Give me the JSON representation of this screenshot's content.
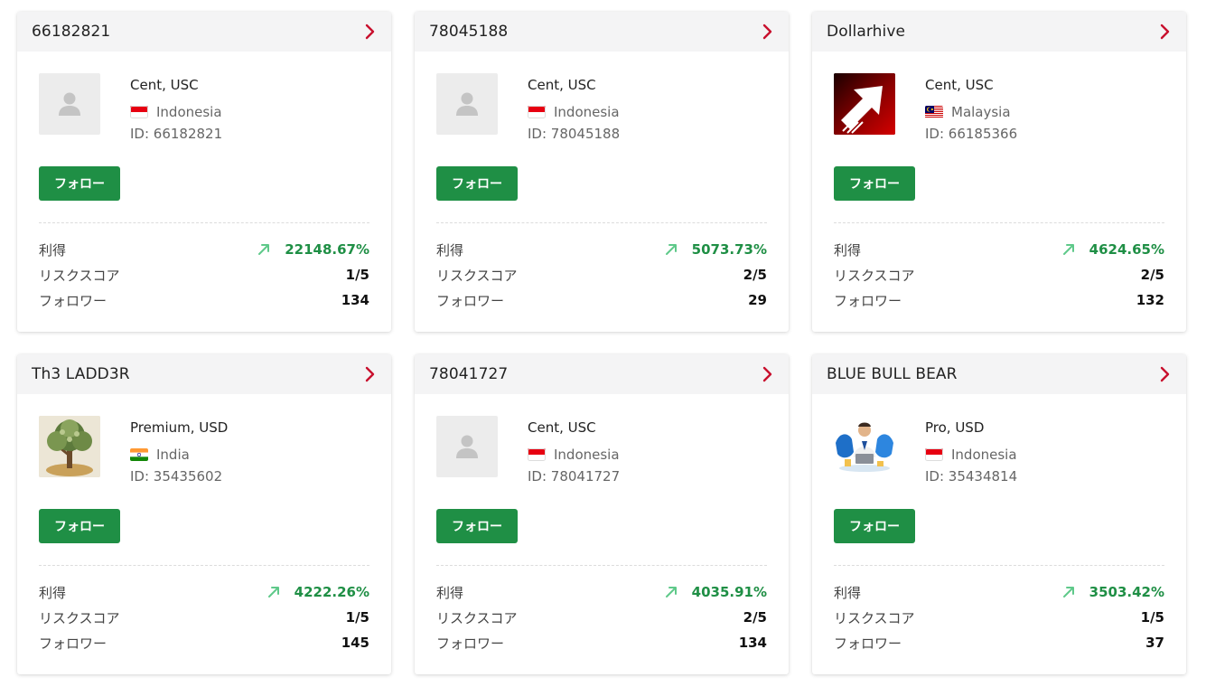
{
  "labels": {
    "follow": "フォロー",
    "profit": "利得",
    "risk": "リスクスコア",
    "followers": "フォロワー"
  },
  "colors": {
    "accent_green": "#1f8f45",
    "chevron_red": "#c8102e",
    "header_bg": "#f4f4f5"
  },
  "cards": [
    {
      "title": "66182821",
      "account": "Cent, USC",
      "country": "Indonesia",
      "flag": "indonesia-flag-icon",
      "id": "ID: 66182821",
      "avatar": "default-user-icon",
      "profit": "22148.67%",
      "risk": "1/5",
      "followers": "134"
    },
    {
      "title": "78045188",
      "account": "Cent, USC",
      "country": "Indonesia",
      "flag": "indonesia-flag-icon",
      "id": "ID: 78045188",
      "avatar": "default-user-icon",
      "profit": "5073.73%",
      "risk": "2/5",
      "followers": "29"
    },
    {
      "title": "Dollarhive",
      "account": "Cent, USC",
      "country": "Malaysia",
      "flag": "malaysia-flag-icon",
      "id": "ID: 66185366",
      "avatar": "red-arrow-logo",
      "profit": "4624.65%",
      "risk": "2/5",
      "followers": "132"
    },
    {
      "title": "Th3 LADD3R",
      "account": "Premium, USD",
      "country": "India",
      "flag": "india-flag-icon",
      "id": "ID: 35435602",
      "avatar": "money-tree-image",
      "profit": "4222.26%",
      "risk": "1/5",
      "followers": "145"
    },
    {
      "title": "78041727",
      "account": "Cent, USC",
      "country": "Indonesia",
      "flag": "indonesia-flag-icon",
      "id": "ID: 78041727",
      "avatar": "default-user-icon",
      "profit": "4035.91%",
      "risk": "2/5",
      "followers": "134"
    },
    {
      "title": "BLUE BULL BEAR",
      "account": "Pro, USD",
      "country": "Indonesia",
      "flag": "indonesia-flag-icon",
      "id": "ID: 35434814",
      "avatar": "bull-bear-trader-image",
      "profit": "3503.42%",
      "risk": "1/5",
      "followers": "37"
    }
  ]
}
